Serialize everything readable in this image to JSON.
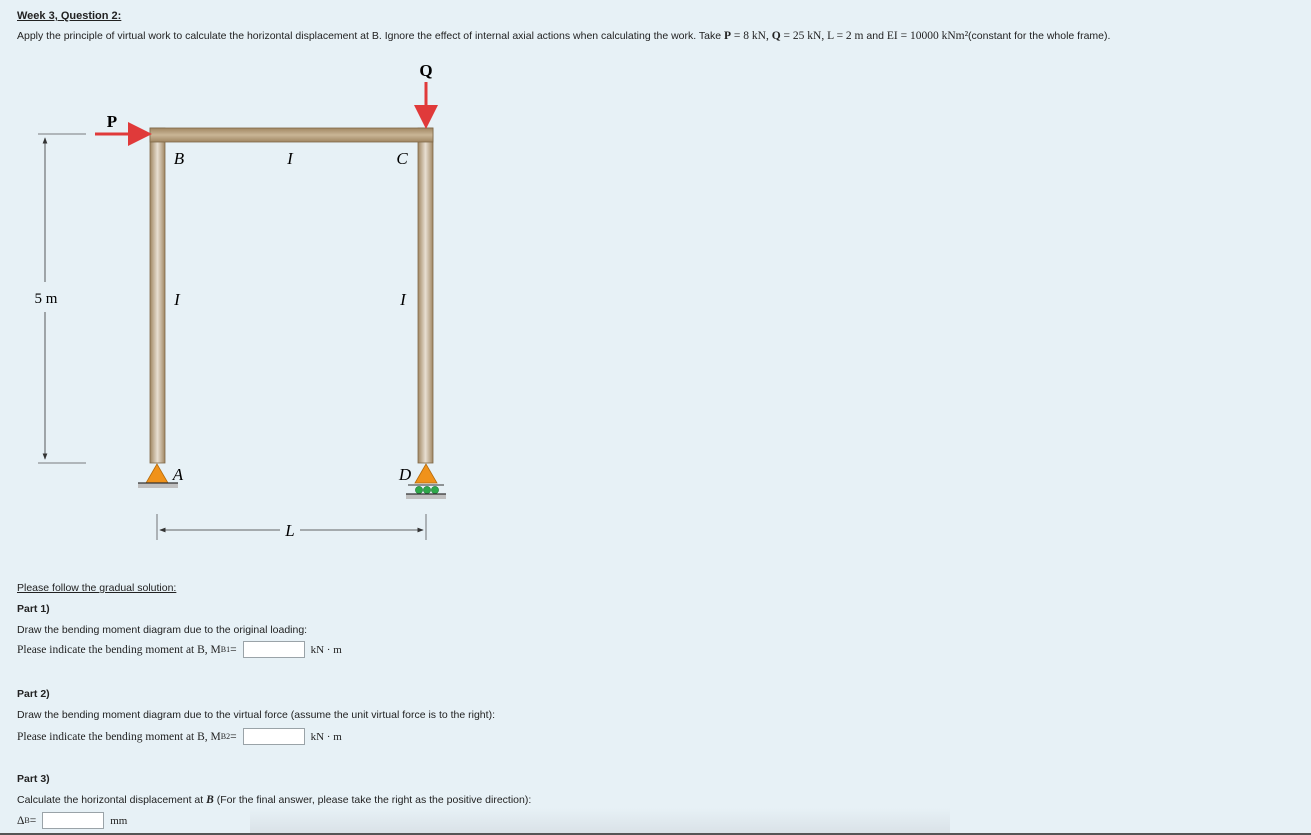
{
  "header": {
    "title": "Week 3, Question 2:",
    "prompt_pre": "Apply the principle of virtual work to calculate the horizontal displacement at B. Ignore the effect of internal axial actions when calculating the work. Take ",
    "p_sym": "P",
    "p_val": " = 8 kN, ",
    "q_sym": "Q",
    "q_val": " = 25 kN, ",
    "l_expr": "L = 2 m",
    "and": " and ",
    "ei_expr": "EI = 10000 kNm²",
    "prompt_post": "(constant for the whole frame)."
  },
  "figure": {
    "label_p": "P",
    "label_q": "Q",
    "label_b": "B",
    "label_c": "C",
    "label_a": "A",
    "label_d": "D",
    "label_i_top": "I",
    "label_i_left": "I",
    "label_i_right": "I",
    "height_dim": "5 m",
    "span_dim": "L",
    "colors": {
      "frame": "#a88e6c",
      "frame_light": "#e2d7c6",
      "load_arrow": "#e03a3a",
      "support": "#f0921a",
      "roller": "#2ea84a"
    }
  },
  "instructions": {
    "gradual": "Please follow the gradual solution:"
  },
  "part1": {
    "head": "Part 1)",
    "text": "Draw the bending moment diagram due to the original loading:",
    "prompt": "Please indicate the bending moment at B, M",
    "sub": "B1",
    "eq": " =",
    "value": "",
    "unit": "kN · m"
  },
  "part2": {
    "head": "Part 2)",
    "text": "Draw the bending moment diagram due to the virtual force (assume the unit virtual force is to the right):",
    "prompt": "Please indicate the bending moment at B, M",
    "sub": "B2",
    "eq": " =",
    "value": "",
    "unit": "kN · m"
  },
  "part3": {
    "head": "Part 3)",
    "text_pre": "Calculate the horizontal displacement at ",
    "text_b": "B",
    "text_post": " (For the final answer, please take the right as the positive direction):",
    "prompt": "Δ",
    "sub": "B",
    "eq": " =",
    "value": "",
    "unit": "mm"
  }
}
